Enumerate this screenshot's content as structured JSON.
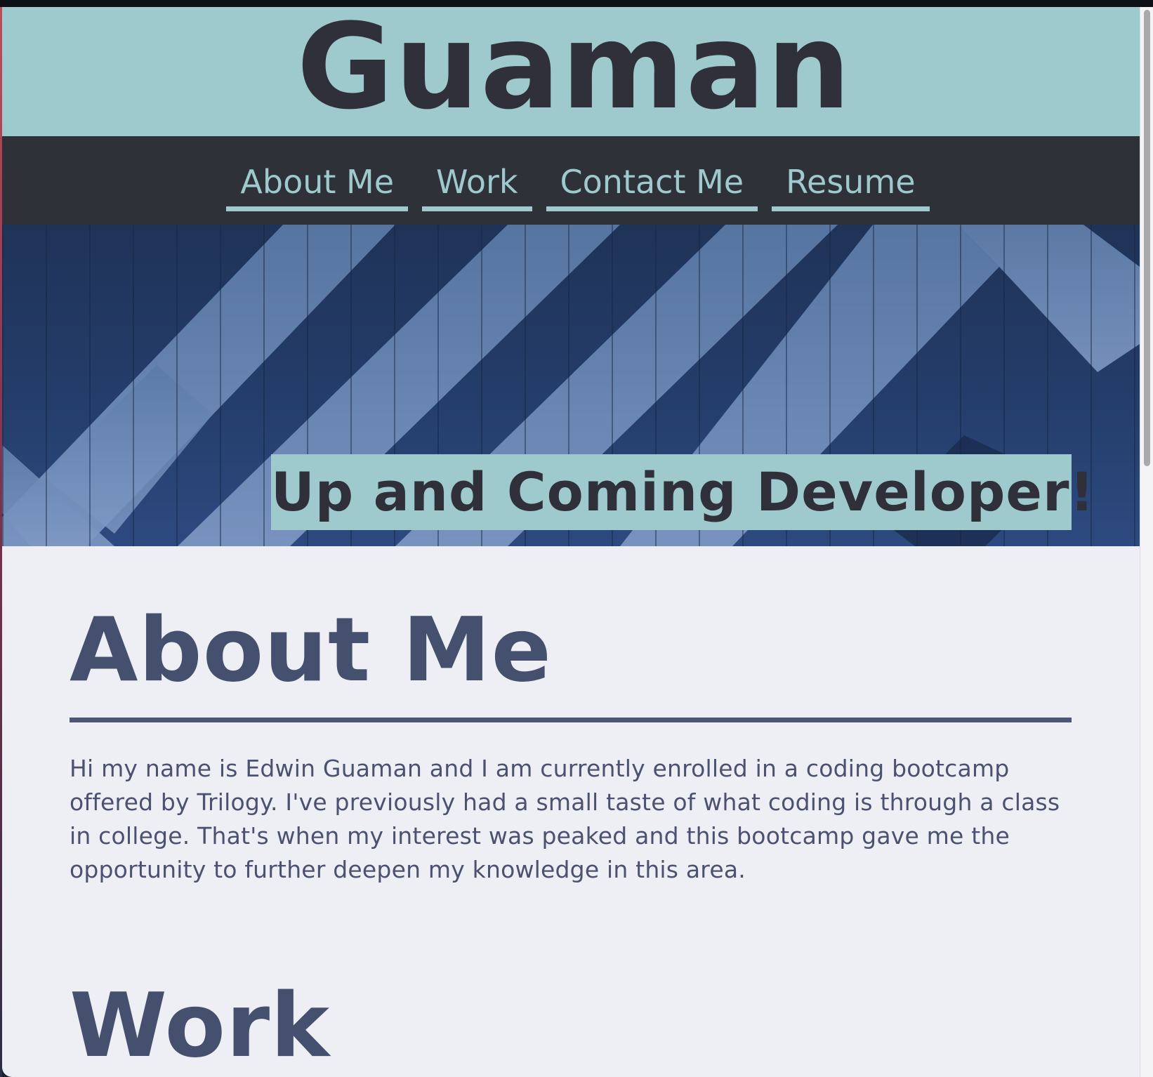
{
  "site": {
    "title": "Guaman"
  },
  "nav": {
    "items": [
      {
        "label": "About Me"
      },
      {
        "label": "Work"
      },
      {
        "label": "Contact Me"
      },
      {
        "label": "Resume"
      }
    ]
  },
  "hero": {
    "tagline": "Up and Coming Developer!"
  },
  "about": {
    "heading": "About Me",
    "text": "Hi my name is Edwin Guaman and I am currently enrolled in a coding bootcamp offered by Trilogy. I've previously had a small taste of what coding is through a class in college. That's when my interest was peaked and this bootcamp gave me the opportunity to further deepen my knowledge in this area."
  },
  "work": {
    "heading": "Work"
  },
  "colors": {
    "accent": "#9ecacd",
    "dark": "#2f3139",
    "heading": "#44506e",
    "background": "#eeeff5"
  }
}
